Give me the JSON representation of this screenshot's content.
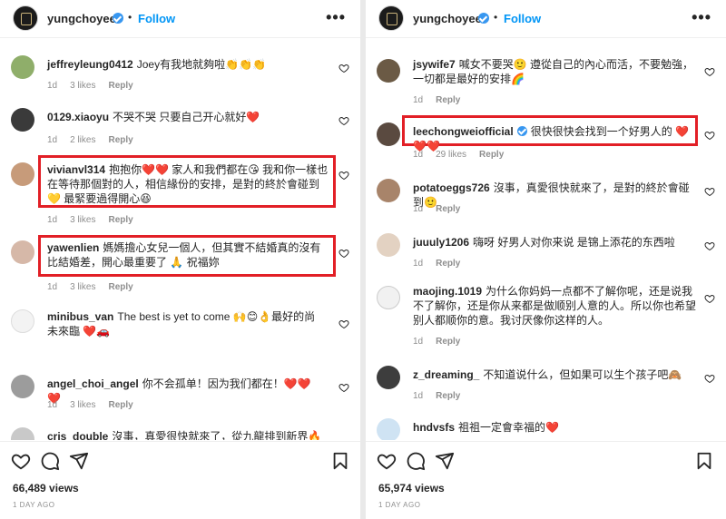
{
  "panels": [
    {
      "header": {
        "username": "yungchoyee",
        "dot": "•",
        "follow_label": "Follow",
        "more_label": "•••"
      },
      "comments": [
        {
          "user": "jeffreyleung0412",
          "text": "Joey有我地就夠啦👏👏👏",
          "time": "1d",
          "likes": "3 likes",
          "reply": "Reply"
        },
        {
          "user": "0129.xiaoyu",
          "text": "不哭不哭 只要自己开心就好❤️",
          "time": "1d",
          "likes": "2 likes",
          "reply": "Reply"
        },
        {
          "user": "vivianvl314",
          "text": "抱抱你❤️❤️ 家人和我們都在😘 我和你一樣也在等待那個對的人，相信緣份的安排，是對的終於會碰到💛 最緊要過得開心😆",
          "time": "1d",
          "likes": "3 likes",
          "reply": "Reply"
        },
        {
          "user": "yawenlien",
          "text": "媽媽擔心女兒一個人，但其實不結婚真的沒有比結婚差，開心最重要了 🙏 祝福妳",
          "time": "1d",
          "likes": "3 likes",
          "reply": "Reply"
        },
        {
          "user": "minibus_van",
          "text": "The best is yet to come 🙌😊👌最好的尚未來臨 ❤️🚗",
          "time": "1d",
          "likes": "",
          "reply": ""
        },
        {
          "user": "angel_choi_angel",
          "text": "你不会孤单！因为我们都在！❤️❤️❤️",
          "time": "1d",
          "likes": "3 likes",
          "reply": "Reply"
        },
        {
          "user": "cris_double",
          "text": "沒事，真愛很快就來了，從九龍排到新界🔥🔥🔥",
          "time": "",
          "likes": "",
          "reply": ""
        }
      ],
      "views": "66,489 views",
      "ago": "1 DAY AGO"
    },
    {
      "header": {
        "username": "yungchoyee",
        "dot": "•",
        "follow_label": "Follow",
        "more_label": "•••"
      },
      "comments": [
        {
          "user": "jsywife7",
          "text": "喊女不要哭🙂 遵從自己的內心而活，不要勉強，一切都是最好的安排🌈",
          "time": "1d",
          "likes": "",
          "reply": "Reply"
        },
        {
          "user": "leechongweiofficial",
          "text": "很快很快会找到一个好男人的 ❤️❤️❤️",
          "time": "1d",
          "likes": "29 likes",
          "reply": "Reply"
        },
        {
          "user": "potatoeggs726",
          "text": "沒事，真愛很快就來了，是對的終於會碰到🙂",
          "time": "1d",
          "likes": "",
          "reply": "Reply"
        },
        {
          "user": "juuuly1206",
          "text": "嗨呀 好男人对你来说 是锦上添花的东西啦",
          "time": "1d",
          "likes": "",
          "reply": "Reply"
        },
        {
          "user": "maojing.1019",
          "text": "为什么你妈妈一点都不了解你呢，还是说我不了解你，还是你从来都是做顺别人意的人。所以你也希望别人都顺你的意。我讨厌像你这样的人。",
          "time": "1d",
          "likes": "",
          "reply": "Reply"
        },
        {
          "user": "z_dreaming_",
          "text": "不知道说什么，但如果可以生个孩子吧🙈",
          "time": "1d",
          "likes": "",
          "reply": "Reply"
        },
        {
          "user": "hndvsfs",
          "text": "祖祖一定會幸福的❤️",
          "time": "",
          "likes": "",
          "reply": ""
        }
      ],
      "views": "65,974 views",
      "ago": "1 DAY AGO"
    }
  ],
  "colors": {
    "highlight": "#e21f26",
    "link": "#0095f6",
    "verified": "#3897f0",
    "meta": "#8e8e8e"
  },
  "icons": [
    "heart-icon",
    "comment-icon",
    "share-icon",
    "bookmark-icon",
    "verified-badge-icon",
    "more-icon"
  ]
}
